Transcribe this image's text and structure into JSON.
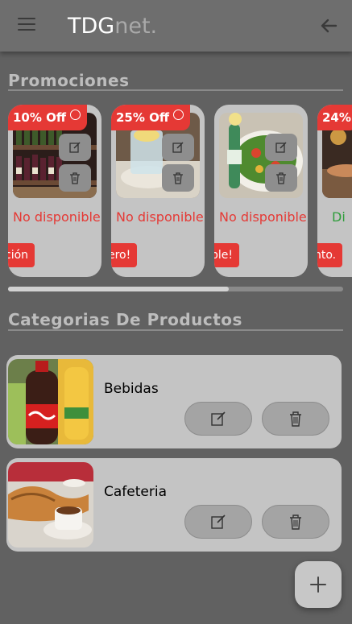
{
  "app": {
    "logo_primary": "TDG",
    "logo_secondary": "net."
  },
  "header": {
    "menu_icon": "menu-icon",
    "back_icon": "arrow-left-icon"
  },
  "promotions": {
    "title": "Promociones",
    "items": [
      {
        "badge": "10% Off",
        "status": "No disponible",
        "tag": "ción"
      },
      {
        "badge": "25% Off",
        "status": "No disponible",
        "tag": "ero!"
      },
      {
        "badge": "",
        "status": "No disponible",
        "tag": "ble!"
      },
      {
        "badge": "24%",
        "status": "Di",
        "tag": "nto."
      }
    ],
    "scroll_position": 0.66
  },
  "categories": {
    "title": "Categorias De Productos",
    "items": [
      {
        "name": "Bebidas"
      },
      {
        "name": "Cafeteria"
      }
    ]
  },
  "fab": {
    "icon": "plus-icon"
  },
  "colors": {
    "accent": "#e53935",
    "available": "#2e9d3a",
    "background": "#616161"
  }
}
